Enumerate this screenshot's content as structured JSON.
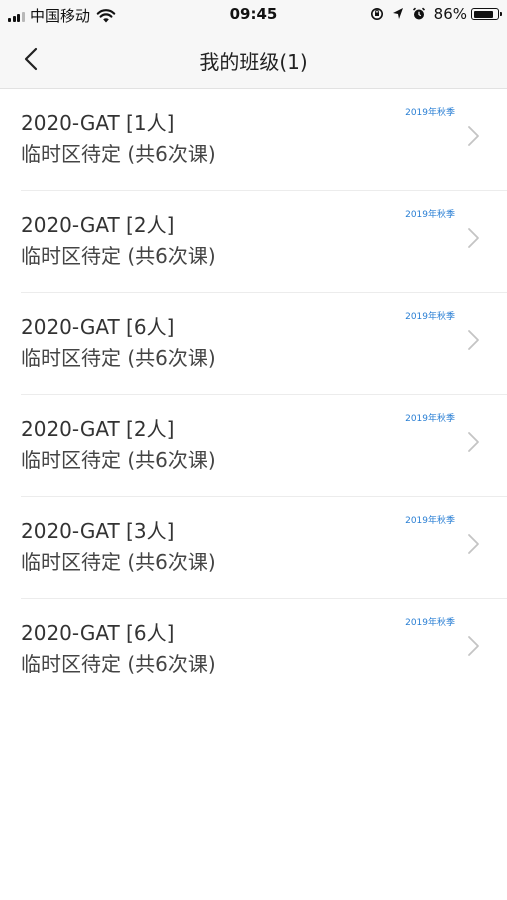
{
  "status_bar": {
    "carrier": "中国移动",
    "time": "09:45",
    "battery": "86%",
    "battery_level": 0.86
  },
  "nav": {
    "title": "我的班级(1)"
  },
  "classes": [
    {
      "name": "2020-GAT [1人]",
      "schedule": "临时区待定 (共6次课)",
      "season": "2019年秋季"
    },
    {
      "name": "2020-GAT [2人]",
      "schedule": "临时区待定 (共6次课)",
      "season": "2019年秋季"
    },
    {
      "name": "2020-GAT [6人]",
      "schedule": "临时区待定 (共6次课)",
      "season": "2019年秋季"
    },
    {
      "name": "2020-GAT [2人]",
      "schedule": "临时区待定 (共6次课)",
      "season": "2019年秋季"
    },
    {
      "name": "2020-GAT [3人]",
      "schedule": "临时区待定 (共6次课)",
      "season": "2019年秋季"
    },
    {
      "name": "2020-GAT [6人]",
      "schedule": "临时区待定 (共6次课)",
      "season": "2019年秋季"
    }
  ],
  "colors": {
    "accent": "#2a7fd4",
    "nav_background": "#f7f7f7",
    "divider": "#ececec"
  },
  "icons": {
    "back": "chevron-left-icon",
    "row_arrow": "chevron-right-icon",
    "wifi": "wifi-icon",
    "orientation_lock": "orientation-lock-icon",
    "location": "location-arrow-icon",
    "alarm": "alarm-icon"
  }
}
